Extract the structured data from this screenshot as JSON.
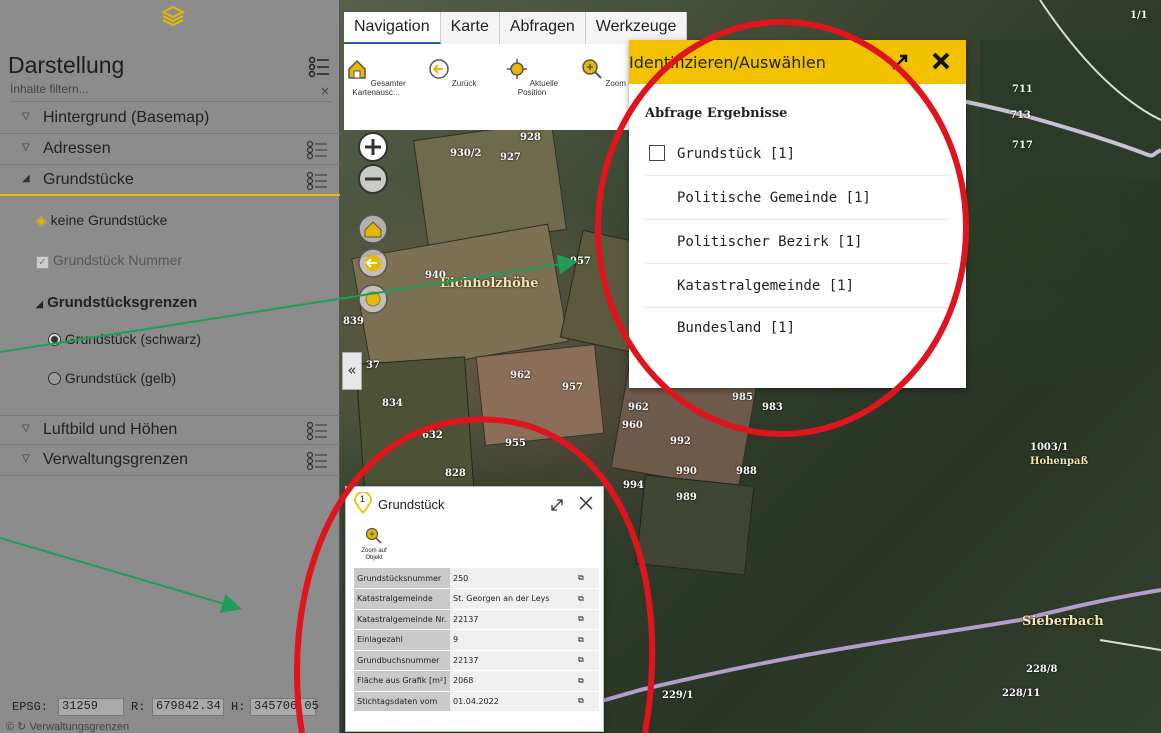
{
  "sidebar": {
    "title": "Darstellung",
    "filter_placeholder": "Inhalte filtern...",
    "filter_clear": "×",
    "layers": [
      {
        "label": "Hintergrund (Basemap)"
      },
      {
        "label": "Adressen"
      },
      {
        "label": "Grundstücke"
      },
      {
        "label": "Luftbild und Höhen"
      },
      {
        "label": "Verwaltungsgrenzen"
      }
    ],
    "sublayers": {
      "keine": "keine Grundstücke",
      "nummer": "Grundstück Nummer",
      "grenzen": "Grundstücksgrenzen",
      "schwarz": "Grundstück (schwarz)",
      "gelb": "Grundstück (gelb)"
    },
    "expanded_arrow": "◢",
    "collapsed_arrow": "▽"
  },
  "statusbar": {
    "epsg_label": "EPSG:",
    "epsg_value": "31259",
    "r_label": "R:",
    "r_value": "679842.34",
    "h_label": "H:",
    "h_value": "345706.05",
    "footer": "Verwaltungsgrenzen"
  },
  "toolbar": {
    "tabs": [
      "Navigation",
      "Karte",
      "Abfragen",
      "Werkzeuge"
    ],
    "tools": [
      "Gesamter Kartenausc...",
      "Zurück",
      "Aktuelle Position",
      "Zoom In"
    ]
  },
  "map": {
    "collapse": "«",
    "labels": [
      "930/2",
      "927",
      "928",
      "940",
      "957",
      "962",
      "957",
      "962",
      "960",
      "992",
      "985",
      "983",
      "955",
      "828",
      "990",
      "988",
      "989",
      "994",
      "711",
      "713",
      "717",
      "1003/1",
      "228/8",
      "228/11",
      "229/1",
      "839",
      "834",
      "632",
      "37",
      "1/1"
    ],
    "places": [
      "Eichholzhöhe",
      "Hohenpaß",
      "Sieberbach"
    ]
  },
  "results": {
    "title": "Identifizieren/Auswählen",
    "heading": "Abfrage Ergebnisse",
    "items": [
      {
        "label": "Grundstück [1]"
      },
      {
        "label": "Politische Gemeinde [1]"
      },
      {
        "label": "Politischer Bezirk [1]"
      },
      {
        "label": "Katastralgemeinde [1]"
      },
      {
        "label": "Bundesland [1]"
      }
    ]
  },
  "grundstueck": {
    "badge": "1",
    "title": "Grundstück",
    "zoom_label": "Zoom auf Objekt",
    "rows": [
      {
        "key": "Grundstücksnummer",
        "value": "250"
      },
      {
        "key": "Katastralgemeinde",
        "value": "St. Georgen an der Leys"
      },
      {
        "key": "Katastralgemeinde Nr.",
        "value": "22137"
      },
      {
        "key": "Einlagezahl",
        "value": "9"
      },
      {
        "key": "Grundbuchsnummer",
        "value": "22137"
      },
      {
        "key": "Fläche aus Grafik [m²]",
        "value": "2068"
      },
      {
        "key": "Stichtagsdaten vom",
        "value": "01.04.2022"
      }
    ]
  },
  "colors": {
    "accent_yellow": "#f2c200",
    "highlight_red": "#e0141c",
    "arrow_green": "#1e9e5a",
    "tab_blue": "#2b5fab"
  }
}
